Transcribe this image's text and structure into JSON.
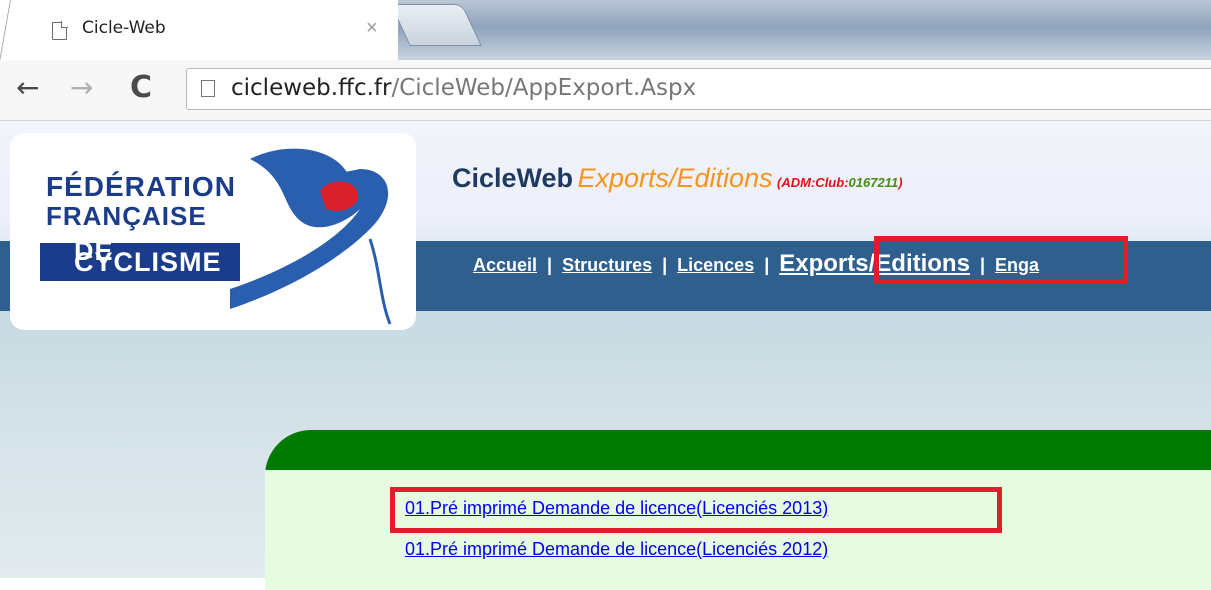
{
  "browser": {
    "tab_title": "Cicle-Web",
    "tab_close": "×",
    "url_host": "cicleweb.ffc.fr",
    "url_path": "/CicleWeb/AppExport.Aspx",
    "back_icon": "←",
    "forward_icon": "→",
    "reload_icon": "C"
  },
  "logo": {
    "line1": "FÉDÉRATION",
    "line2": "FRANÇAISE",
    "band_prefix": "DE",
    "band_text": "CYCLISME"
  },
  "header": {
    "brand": "CicleWeb",
    "section": "Exports/Editions",
    "adm_prefix": "(ADM:Club:",
    "club_code": "0167211",
    "adm_suffix": ")"
  },
  "menu": {
    "items": [
      {
        "label": "Accueil"
      },
      {
        "label": "Structures"
      },
      {
        "label": "Licences"
      },
      {
        "label": "Exports/Editions"
      },
      {
        "label": "Enga"
      }
    ],
    "separator": "|"
  },
  "exports": {
    "links": [
      {
        "label": "01.Pré imprimé Demande de licence(Licenciés 2013)"
      },
      {
        "label": "01.Pré imprimé Demande de licence(Licenciés 2012)"
      }
    ]
  },
  "colors": {
    "highlight": "#e21c2b",
    "navbar": "#2f5f8d",
    "panel_header": "#007a00",
    "section_orange": "#f7941d"
  }
}
